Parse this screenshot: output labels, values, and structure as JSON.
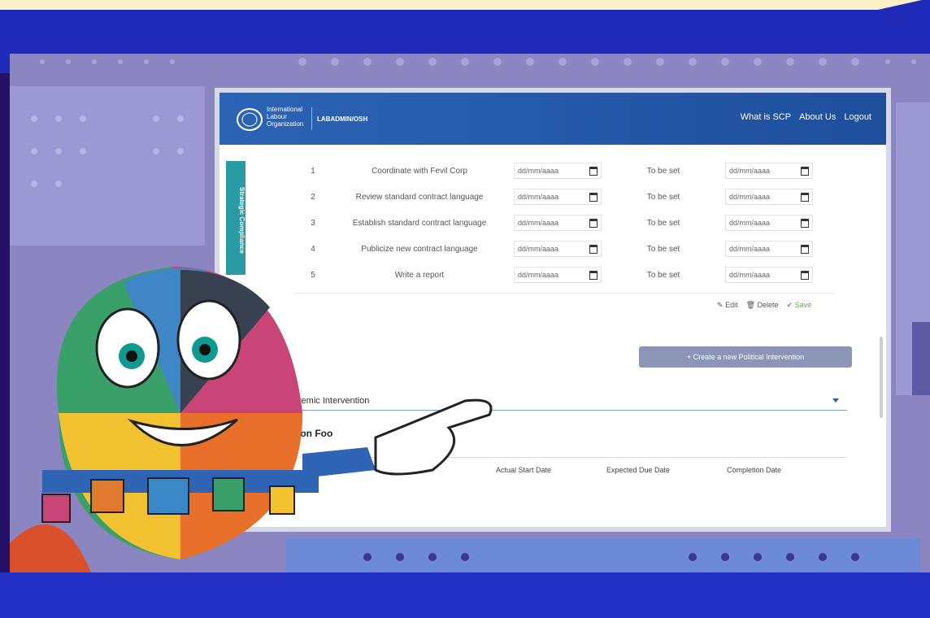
{
  "header": {
    "org_name_line1": "International",
    "org_name_line2": "Labour",
    "org_name_line3": "Organization",
    "logo_acronym": "ILO",
    "app_name": "LABADMIN/OSH",
    "nav": [
      "What is SCP",
      "About Us",
      "Logout"
    ]
  },
  "side_tab": {
    "label": "Strategic Compliance"
  },
  "tasks": {
    "rows": [
      {
        "num": "1",
        "name": "Coordinate with Fevil Corp",
        "start": "dd/mm/aaaa",
        "status": "To be set",
        "due": "dd/mm/aaaa"
      },
      {
        "num": "2",
        "name": "Review standard contract language",
        "start": "dd/mm/aaaa",
        "status": "To be set",
        "due": "dd/mm/aaaa"
      },
      {
        "num": "3",
        "name": "Establish standard contract language",
        "start": "dd/mm/aaaa",
        "status": "To be set",
        "due": "dd/mm/aaaa"
      },
      {
        "num": "4",
        "name": "Publicize new contract language",
        "start": "dd/mm/aaaa",
        "status": "To be set",
        "due": "dd/mm/aaaa"
      },
      {
        "num": "5",
        "name": "Write a report",
        "start": "dd/mm/aaaa",
        "status": "To be set",
        "due": "dd/mm/aaaa"
      }
    ],
    "actions": {
      "edit": "Edit",
      "delete": "Delete",
      "save": "Save"
    }
  },
  "create_button": "+ Create a new Political Intervention",
  "section_dropdown": "stemic Intervention",
  "section_title": "Lon Foo",
  "columns": [
    "Actual Start Date",
    "Expected Due Date",
    "Completion Date"
  ],
  "colors": {
    "background": "#1f2bb8",
    "header": "#2d63b4",
    "teal_tab": "#2a9aa4",
    "save_green": "#5aae3e",
    "banner": "#fbefc6"
  }
}
